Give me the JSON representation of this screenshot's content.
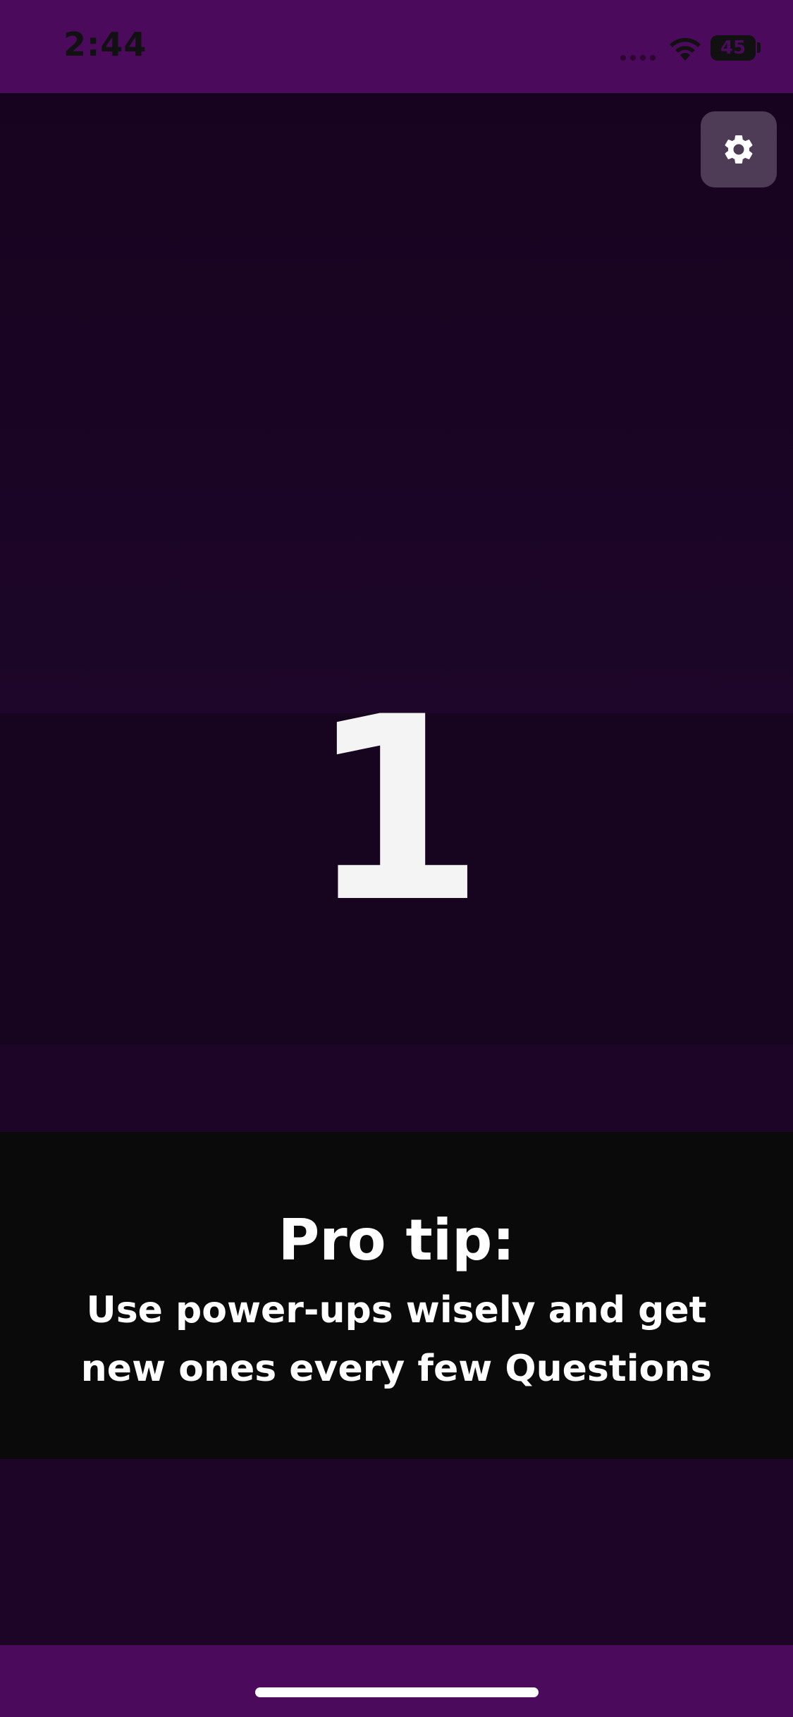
{
  "status_bar": {
    "time": "2:44",
    "battery": "45",
    "icons": [
      "signal-dots-icon",
      "wifi-icon",
      "battery-icon"
    ]
  },
  "settings": {
    "icon": "gear-icon"
  },
  "countdown": {
    "value": "1"
  },
  "tip": {
    "title": "Pro tip:",
    "text": "Use power-ups wisely and get new ones every few Questions"
  },
  "colors": {
    "frame": "#4c0a5d",
    "background": "#1c0526",
    "banner": "#0a0a0a",
    "settings_button": "#4e3c56",
    "text": "#ffffff"
  }
}
